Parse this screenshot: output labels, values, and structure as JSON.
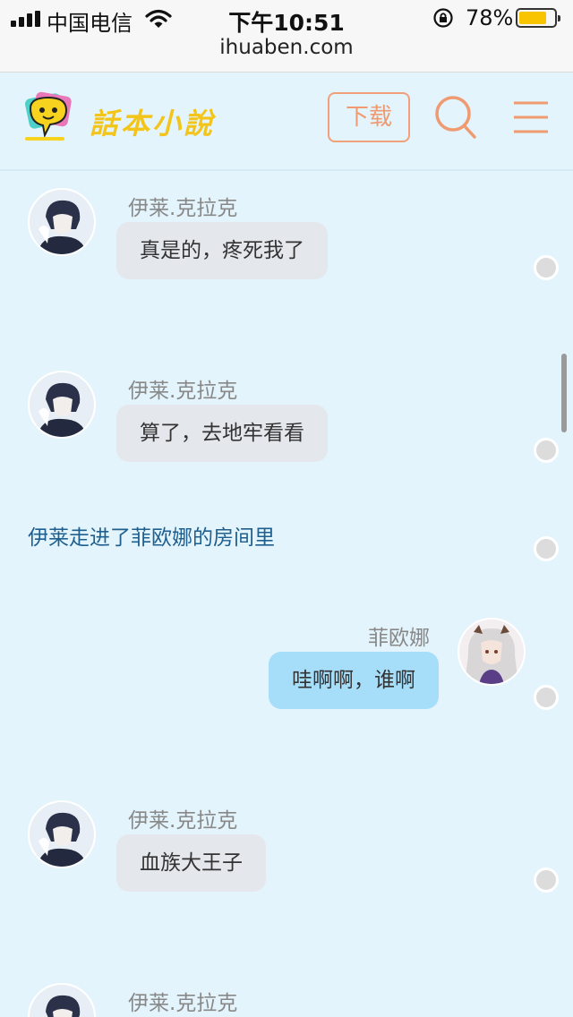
{
  "status_bar": {
    "carrier": "中国电信",
    "time": "下午10:51",
    "battery_percent": "78%",
    "battery_level": 0.78,
    "url": "ihuaben.com"
  },
  "header": {
    "logo_text": "話本小說",
    "download_label": "下载",
    "icons": [
      "search-icon",
      "menu-icon"
    ],
    "accent_color": "#ef9a70"
  },
  "chat": {
    "messages": [
      {
        "type": "left",
        "name": "伊莱.克拉克",
        "text": "真是的，疼死我了"
      },
      {
        "type": "left",
        "name": "伊莱.克拉克",
        "text": "算了，去地牢看看"
      },
      {
        "type": "narration",
        "text": "伊莱走进了菲欧娜的房间里"
      },
      {
        "type": "right",
        "name": "菲欧娜",
        "text": "哇啊啊，谁啊"
      },
      {
        "type": "left",
        "name": "伊莱.克拉克",
        "text": "血族大王子"
      },
      {
        "type": "left",
        "name": "伊莱.克拉克",
        "text": ""
      }
    ]
  }
}
